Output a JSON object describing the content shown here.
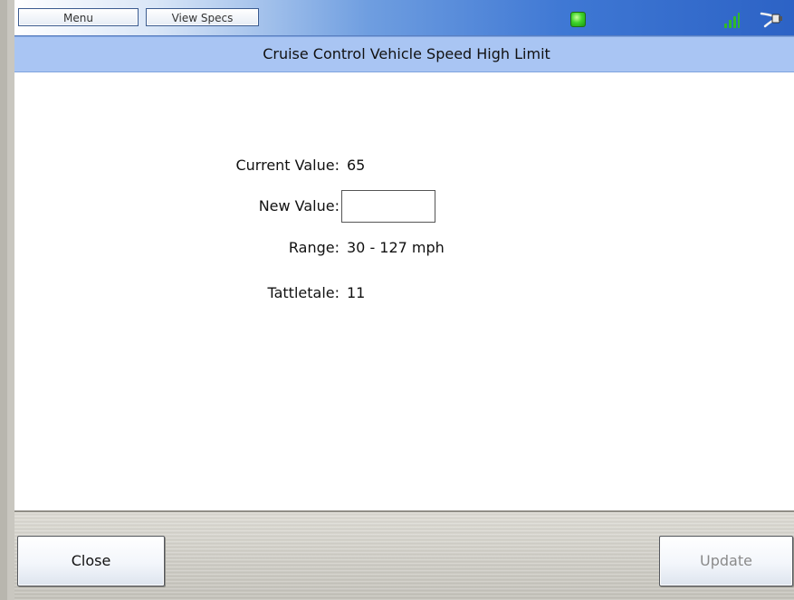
{
  "toolbar": {
    "menu_label": "Menu",
    "view_specs_label": "View Specs",
    "status_icon": "green-status-led",
    "signal_icon": "signal-strength-icon",
    "connection_icon": "plug-connection-icon"
  },
  "title": "Cruise Control Vehicle Speed High Limit",
  "fields": {
    "current_value_label": "Current Value:",
    "current_value": "65",
    "new_value_label": "New Value:",
    "new_value": "",
    "range_label": "Range:",
    "range_value": "30 - 127 mph",
    "tattletale_label": "Tattletale:",
    "tattletale_value": "11"
  },
  "buttons": {
    "close_label": "Close",
    "update_label": "Update"
  },
  "colors": {
    "title_bar": "#a9c5f3",
    "status_led": "#3fd42b",
    "signal_bars": "#2fb82a"
  }
}
